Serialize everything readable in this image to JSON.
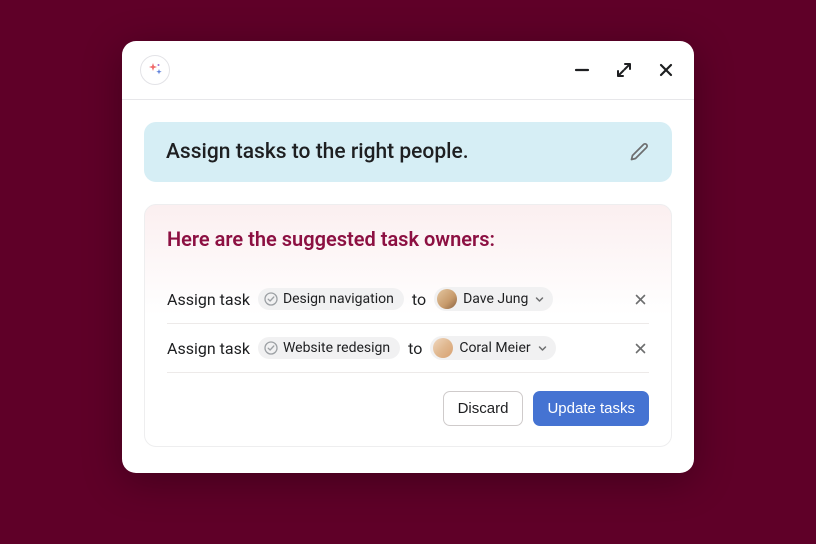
{
  "prompt": {
    "text": "Assign tasks to the right people."
  },
  "suggestions": {
    "title": "Here are the suggested task owners:",
    "rows": [
      {
        "assign_label": "Assign task",
        "task_name": "Design navigation",
        "to_label": "to",
        "person_name": "Dave Jung"
      },
      {
        "assign_label": "Assign task",
        "task_name": "Website redesign",
        "to_label": "to",
        "person_name": "Coral Meier"
      }
    ]
  },
  "actions": {
    "discard": "Discard",
    "update": "Update tasks"
  },
  "icons": {
    "ai": "sparkle-icon",
    "minimize": "minimize-icon",
    "expand": "expand-icon",
    "close": "close-icon",
    "edit": "pencil-icon",
    "check": "check-circle-icon",
    "chevron": "chevron-down-icon",
    "remove": "x-icon"
  },
  "colors": {
    "background": "#5f0028",
    "promptBanner": "#d6eef5",
    "suggestionsTitle": "#8c1042",
    "primaryButton": "#4573d2"
  }
}
